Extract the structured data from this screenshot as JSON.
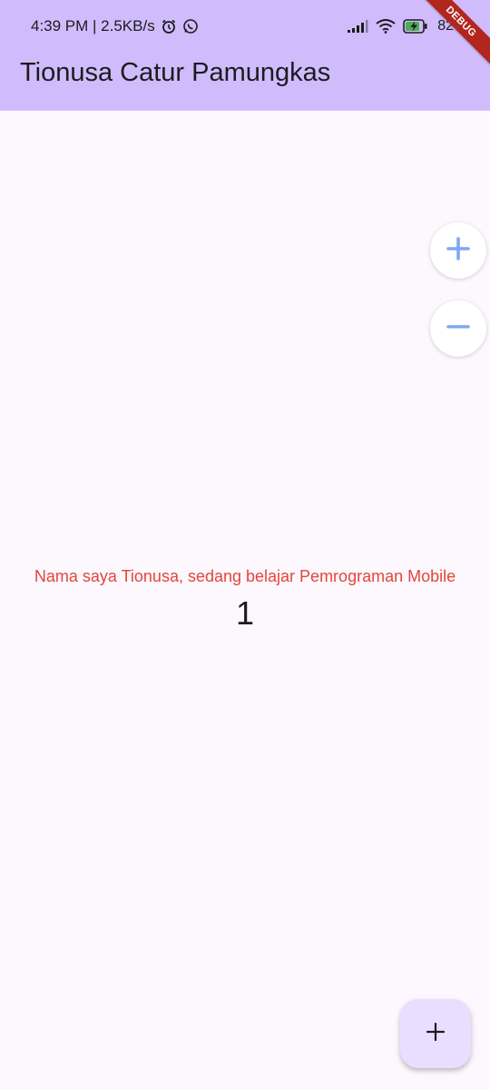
{
  "status_bar": {
    "time_speed": "4:39 PM | 2.5KB/s",
    "battery": "82",
    "icons": [
      "alarm-icon",
      "whatsapp-icon",
      "signal-icon",
      "wifi-icon",
      "battery-charging-icon"
    ]
  },
  "debug_banner": "DEBUG",
  "app_bar": {
    "title": "Tionusa Catur Pamungkas"
  },
  "zoom_controls": {
    "in_icon": "plus-icon",
    "out_icon": "minus-icon"
  },
  "body": {
    "message": "Nama saya Tionusa, sedang belajar Pemrograman Mobile",
    "counter": "1"
  },
  "fab": {
    "icon": "plus-icon"
  },
  "colors": {
    "app_bar": "#d0bcfc",
    "background": "#fdf7fe",
    "message_text": "#e3463b",
    "zoom_icon": "#7ea9ef",
    "fab": "#eaddff",
    "debug_banner": "#b3261e"
  }
}
